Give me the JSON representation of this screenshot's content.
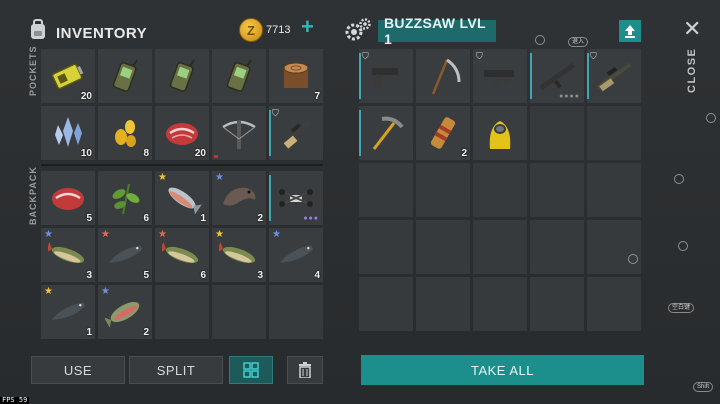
{
  "inventory": {
    "title": "INVENTORY",
    "coins": "7713",
    "coin_symbol": "Z",
    "pockets_label": "POCKETS",
    "backpack_label": "BACKPACK",
    "pockets": [
      {
        "icon": "battery-icon",
        "count": "20"
      },
      {
        "icon": "walkie-talkie-icon",
        "count": ""
      },
      {
        "icon": "walkie-talkie-icon",
        "count": ""
      },
      {
        "icon": "walkie-talkie-icon",
        "count": ""
      },
      {
        "icon": "log-icon",
        "count": "7"
      },
      {
        "icon": "crystal-icon",
        "count": "10"
      },
      {
        "icon": "corn-seeds-icon",
        "count": "8"
      },
      {
        "icon": "raw-meat-icon",
        "count": "20"
      },
      {
        "icon": "crossbow-icon",
        "count": ""
      },
      {
        "icon": "rifle-icon",
        "count": ""
      }
    ],
    "backpack": [
      {
        "icon": "raw-meat-icon",
        "count": "5"
      },
      {
        "icon": "plant-icon",
        "count": "6"
      },
      {
        "icon": "salmon-icon",
        "count": "1",
        "star": "gold"
      },
      {
        "icon": "catfish-icon",
        "count": "2",
        "star": "blue"
      },
      {
        "icon": "drone-icon",
        "count": ""
      },
      {
        "icon": "pike-icon",
        "count": "3",
        "star": "blue"
      },
      {
        "icon": "sturgeon-icon",
        "count": "5",
        "star": "red"
      },
      {
        "icon": "pike-icon",
        "count": "6",
        "star": "red"
      },
      {
        "icon": "pike-icon",
        "count": "3",
        "star": "gold"
      },
      {
        "icon": "sturgeon-icon",
        "count": "4",
        "star": "blue"
      },
      {
        "icon": "sturgeon-icon",
        "count": "1",
        "star": "gold"
      },
      {
        "icon": "trout-icon",
        "count": "2",
        "star": "blue"
      }
    ],
    "buttons": {
      "use": "USE",
      "split": "SPLIT"
    }
  },
  "container": {
    "title": "BUZZSAW LVL 1",
    "items": [
      {
        "icon": "pistol-icon",
        "count": ""
      },
      {
        "icon": "scythe-icon",
        "count": ""
      },
      {
        "icon": "uzi-icon",
        "count": ""
      },
      {
        "icon": "assault-rifle-icon",
        "count": ""
      },
      {
        "icon": "sniper-rifle-icon",
        "count": ""
      },
      {
        "icon": "pickaxe-icon",
        "count": ""
      },
      {
        "icon": "bandage-icon",
        "count": "2"
      },
      {
        "icon": "hazmat-suit-icon",
        "count": ""
      }
    ],
    "take_all": "TAKE ALL"
  },
  "close_label": "CLOSE",
  "hints": {
    "keyhint": "退入",
    "enter": "空白键",
    "shift": "Shift"
  },
  "fps": "FPS 59",
  "colors": {
    "accent": "#1c8e8c",
    "slot": "#3a3d3f",
    "background": "#2b2e30",
    "coin": "#e8b23a",
    "star_gold": "#f2c230",
    "star_blue": "#6f8fe3",
    "star_red": "#e06b55"
  }
}
